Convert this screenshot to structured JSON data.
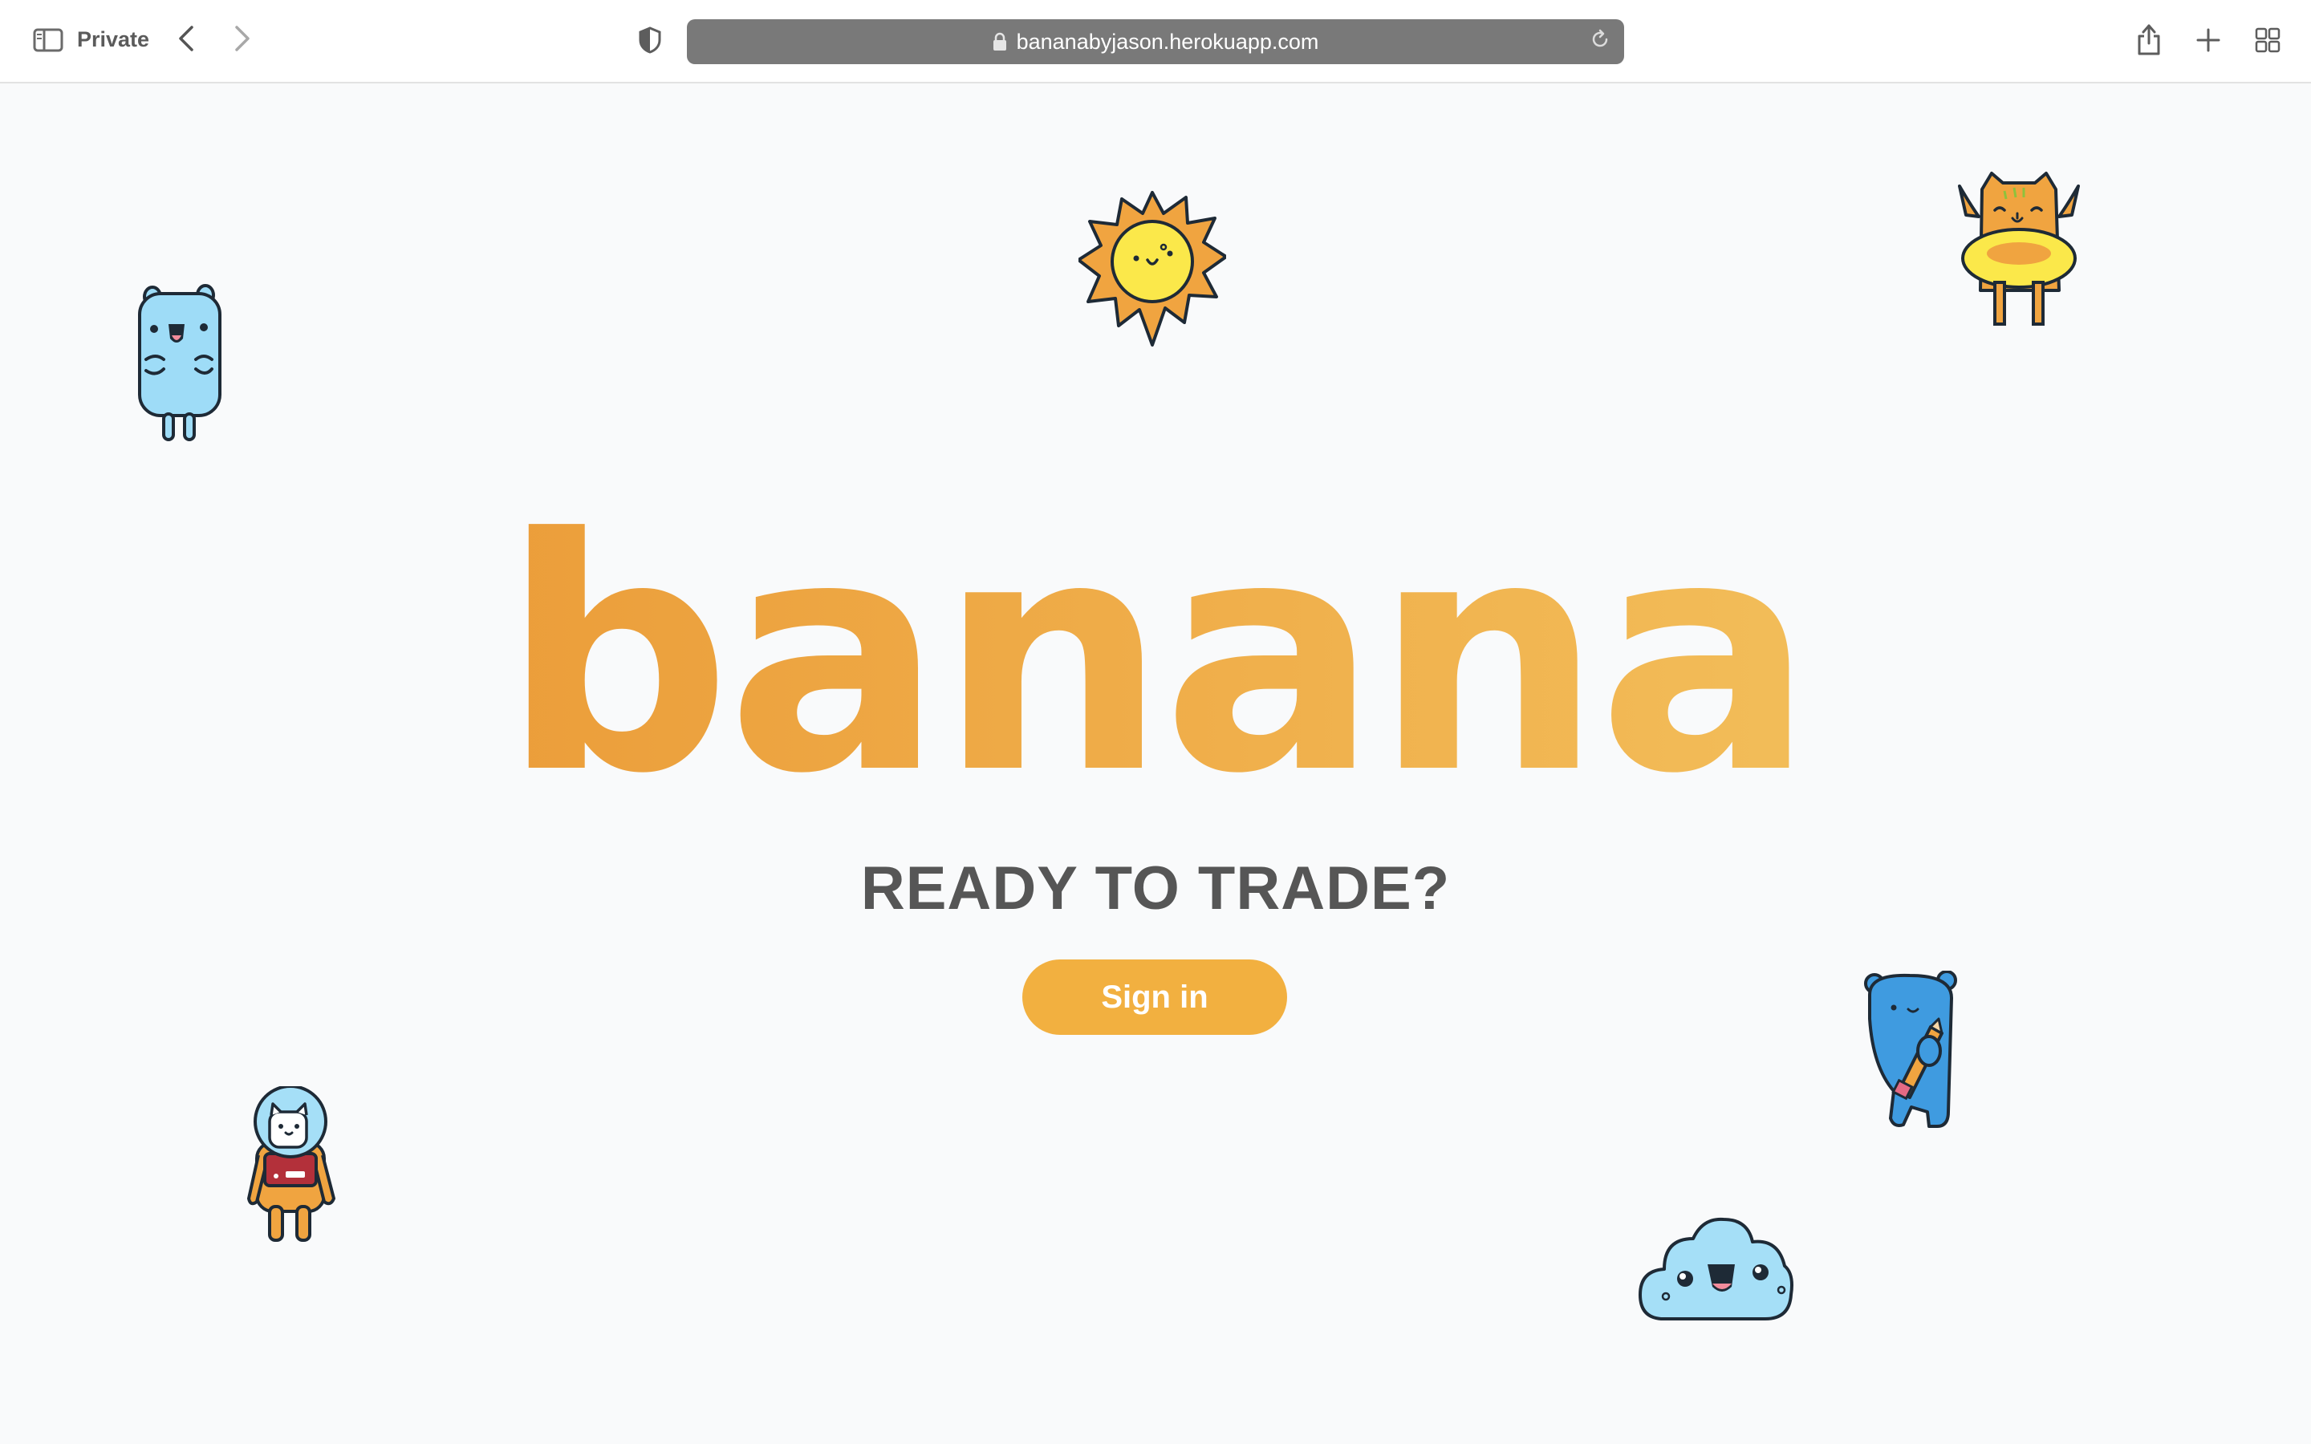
{
  "browser": {
    "private_label": "Private",
    "url": "bananabyjason.herokuapp.com"
  },
  "hero": {
    "logo_text": "banana",
    "tagline": "READY TO TRADE?",
    "signin_label": "Sign in"
  },
  "colors": {
    "accent": "#f2b040",
    "logo_start": "#e8922f",
    "logo_end": "#f5c965",
    "tagline": "#565656"
  },
  "icons": {
    "sidebar": "sidebar-icon",
    "back": "chevron-left-icon",
    "forward": "chevron-right-icon",
    "privacy": "shield-icon",
    "lock": "lock-icon",
    "reload": "reload-icon",
    "share": "share-icon",
    "new_tab": "plus-icon",
    "tab_overview": "grid-icon"
  }
}
